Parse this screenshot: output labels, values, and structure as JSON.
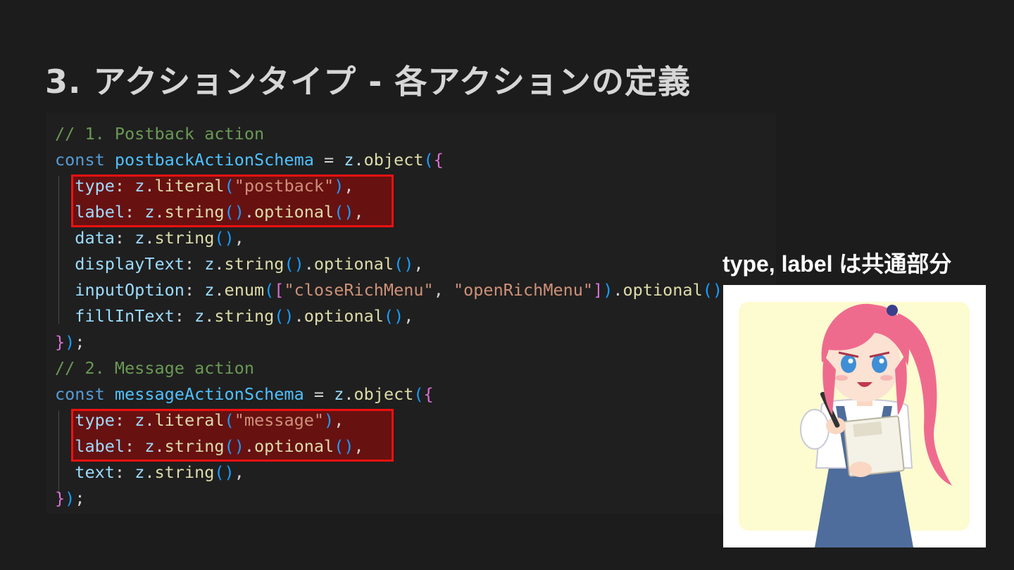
{
  "slide": {
    "title": "3. アクションタイプ - 各アクションの定義"
  },
  "code": {
    "lines": [
      [
        {
          "t": "// 1. Postback action",
          "c": "comment"
        }
      ],
      [
        {
          "t": "const",
          "c": "keyword"
        },
        {
          "t": " ",
          "c": "plain"
        },
        {
          "t": "postbackActionSchema",
          "c": "var"
        },
        {
          "t": " = ",
          "c": "plain"
        },
        {
          "t": "z",
          "c": "prop"
        },
        {
          "t": ".",
          "c": "plain"
        },
        {
          "t": "object",
          "c": "fn"
        },
        {
          "t": "(",
          "c": "paren"
        },
        {
          "t": "{",
          "c": "brace2"
        }
      ],
      [
        {
          "t": "  ",
          "c": "plain"
        },
        {
          "t": "type",
          "c": "prop"
        },
        {
          "t": ": ",
          "c": "plain"
        },
        {
          "t": "z",
          "c": "prop"
        },
        {
          "t": ".",
          "c": "plain"
        },
        {
          "t": "literal",
          "c": "fn"
        },
        {
          "t": "(",
          "c": "paren"
        },
        {
          "t": "\"postback\"",
          "c": "str"
        },
        {
          "t": ")",
          "c": "paren"
        },
        {
          "t": ",",
          "c": "plain"
        }
      ],
      [
        {
          "t": "  ",
          "c": "plain"
        },
        {
          "t": "label",
          "c": "prop"
        },
        {
          "t": ": ",
          "c": "plain"
        },
        {
          "t": "z",
          "c": "prop"
        },
        {
          "t": ".",
          "c": "plain"
        },
        {
          "t": "string",
          "c": "fn"
        },
        {
          "t": "()",
          "c": "paren"
        },
        {
          "t": ".",
          "c": "plain"
        },
        {
          "t": "optional",
          "c": "fn"
        },
        {
          "t": "()",
          "c": "paren"
        },
        {
          "t": ",",
          "c": "plain"
        }
      ],
      [
        {
          "t": "  ",
          "c": "plain"
        },
        {
          "t": "data",
          "c": "prop"
        },
        {
          "t": ": ",
          "c": "plain"
        },
        {
          "t": "z",
          "c": "prop"
        },
        {
          "t": ".",
          "c": "plain"
        },
        {
          "t": "string",
          "c": "fn"
        },
        {
          "t": "()",
          "c": "paren"
        },
        {
          "t": ",",
          "c": "plain"
        }
      ],
      [
        {
          "t": "  ",
          "c": "plain"
        },
        {
          "t": "displayText",
          "c": "prop"
        },
        {
          "t": ": ",
          "c": "plain"
        },
        {
          "t": "z",
          "c": "prop"
        },
        {
          "t": ".",
          "c": "plain"
        },
        {
          "t": "string",
          "c": "fn"
        },
        {
          "t": "()",
          "c": "paren"
        },
        {
          "t": ".",
          "c": "plain"
        },
        {
          "t": "optional",
          "c": "fn"
        },
        {
          "t": "()",
          "c": "paren"
        },
        {
          "t": ",",
          "c": "plain"
        }
      ],
      [
        {
          "t": "  ",
          "c": "plain"
        },
        {
          "t": "inputOption",
          "c": "prop"
        },
        {
          "t": ": ",
          "c": "plain"
        },
        {
          "t": "z",
          "c": "prop"
        },
        {
          "t": ".",
          "c": "plain"
        },
        {
          "t": "enum",
          "c": "fn"
        },
        {
          "t": "(",
          "c": "paren"
        },
        {
          "t": "[",
          "c": "brace2"
        },
        {
          "t": "\"closeRichMenu\"",
          "c": "str"
        },
        {
          "t": ", ",
          "c": "plain"
        },
        {
          "t": "\"openRichMenu\"",
          "c": "str"
        },
        {
          "t": "]",
          "c": "brace2"
        },
        {
          "t": ")",
          "c": "paren"
        },
        {
          "t": ".",
          "c": "plain"
        },
        {
          "t": "optional",
          "c": "fn"
        },
        {
          "t": "()",
          "c": "paren"
        },
        {
          "t": ",",
          "c": "plain"
        }
      ],
      [
        {
          "t": "  ",
          "c": "plain"
        },
        {
          "t": "fillInText",
          "c": "prop"
        },
        {
          "t": ": ",
          "c": "plain"
        },
        {
          "t": "z",
          "c": "prop"
        },
        {
          "t": ".",
          "c": "plain"
        },
        {
          "t": "string",
          "c": "fn"
        },
        {
          "t": "()",
          "c": "paren"
        },
        {
          "t": ".",
          "c": "plain"
        },
        {
          "t": "optional",
          "c": "fn"
        },
        {
          "t": "()",
          "c": "paren"
        },
        {
          "t": ",",
          "c": "plain"
        }
      ],
      [
        {
          "t": "}",
          "c": "brace2"
        },
        {
          "t": ")",
          "c": "paren"
        },
        {
          "t": ";",
          "c": "plain"
        }
      ],
      [
        {
          "t": "// 2. Message action",
          "c": "comment"
        }
      ],
      [
        {
          "t": "const",
          "c": "keyword"
        },
        {
          "t": " ",
          "c": "plain"
        },
        {
          "t": "messageActionSchema",
          "c": "var"
        },
        {
          "t": " = ",
          "c": "plain"
        },
        {
          "t": "z",
          "c": "prop"
        },
        {
          "t": ".",
          "c": "plain"
        },
        {
          "t": "object",
          "c": "fn"
        },
        {
          "t": "(",
          "c": "paren"
        },
        {
          "t": "{",
          "c": "brace2"
        }
      ],
      [
        {
          "t": "  ",
          "c": "plain"
        },
        {
          "t": "type",
          "c": "prop"
        },
        {
          "t": ": ",
          "c": "plain"
        },
        {
          "t": "z",
          "c": "prop"
        },
        {
          "t": ".",
          "c": "plain"
        },
        {
          "t": "literal",
          "c": "fn"
        },
        {
          "t": "(",
          "c": "paren"
        },
        {
          "t": "\"message\"",
          "c": "str"
        },
        {
          "t": ")",
          "c": "paren"
        },
        {
          "t": ",",
          "c": "plain"
        }
      ],
      [
        {
          "t": "  ",
          "c": "plain"
        },
        {
          "t": "label",
          "c": "prop"
        },
        {
          "t": ": ",
          "c": "plain"
        },
        {
          "t": "z",
          "c": "prop"
        },
        {
          "t": ".",
          "c": "plain"
        },
        {
          "t": "string",
          "c": "fn"
        },
        {
          "t": "()",
          "c": "paren"
        },
        {
          "t": ".",
          "c": "plain"
        },
        {
          "t": "optional",
          "c": "fn"
        },
        {
          "t": "()",
          "c": "paren"
        },
        {
          "t": ",",
          "c": "plain"
        }
      ],
      [
        {
          "t": "  ",
          "c": "plain"
        },
        {
          "t": "text",
          "c": "prop"
        },
        {
          "t": ": ",
          "c": "plain"
        },
        {
          "t": "z",
          "c": "prop"
        },
        {
          "t": ".",
          "c": "plain"
        },
        {
          "t": "string",
          "c": "fn"
        },
        {
          "t": "()",
          "c": "paren"
        },
        {
          "t": ",",
          "c": "plain"
        }
      ],
      [
        {
          "t": "}",
          "c": "brace2"
        },
        {
          "t": ")",
          "c": "paren"
        },
        {
          "t": ";",
          "c": "plain"
        }
      ]
    ]
  },
  "caption": {
    "text": "type, label は共通部分"
  },
  "illustration": {
    "icon": "anime-girl-holding-pen-and-papers-illustration"
  },
  "colors": {
    "background": "#1c1c1c",
    "code_background": "#1f1f1f",
    "highlight_border": "#ee1111"
  }
}
